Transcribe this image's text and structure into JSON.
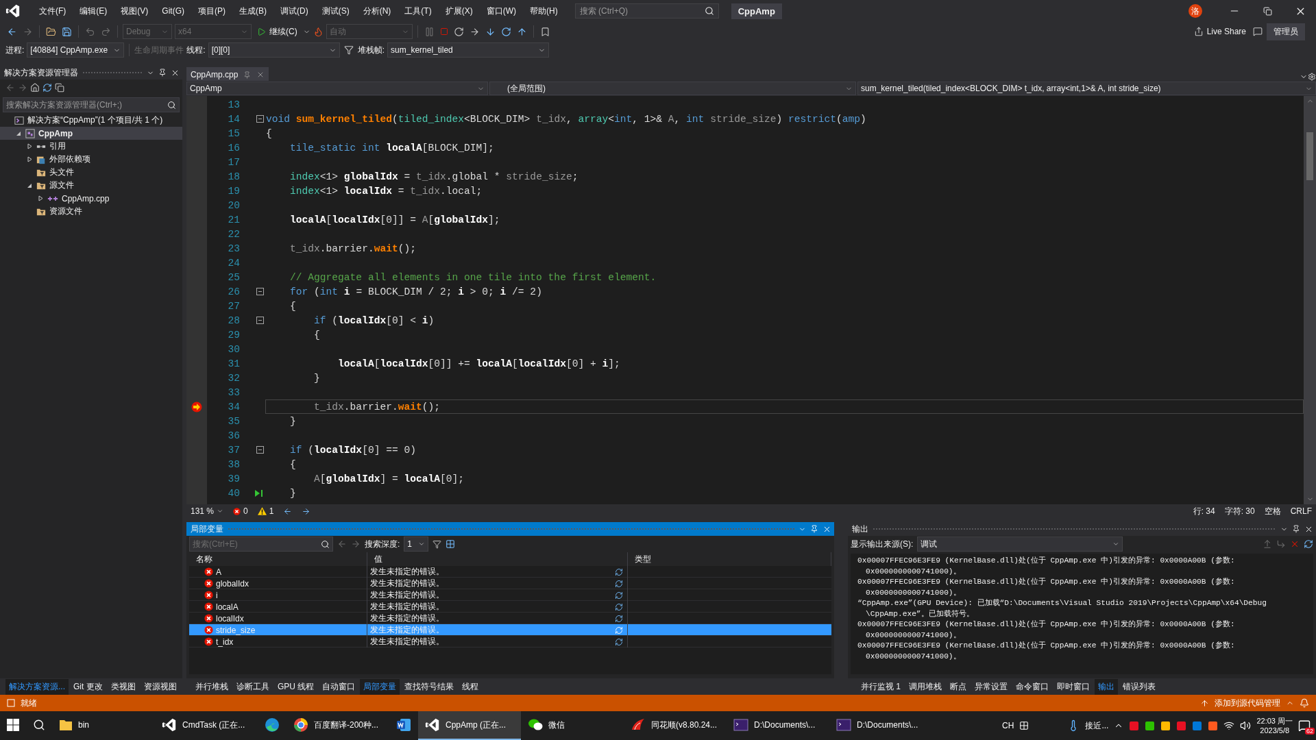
{
  "title_bar": {
    "menus": [
      "文件(F)",
      "编辑(E)",
      "视图(V)",
      "Git(G)",
      "项目(P)",
      "生成(B)",
      "调试(D)",
      "测试(S)",
      "分析(N)",
      "工具(T)",
      "扩展(X)",
      "窗口(W)",
      "帮助(H)"
    ],
    "search_placeholder": "搜索 (Ctrl+Q)",
    "title": "CppAmp",
    "avatar": "洛",
    "live_share": "Live Share",
    "admin": "管理员"
  },
  "toolbar": {
    "configuration": "Debug",
    "platform": "x64",
    "continue": "继续(C)",
    "auto": "自动"
  },
  "debug_location": {
    "process_label": "进程:",
    "process": "[40884] CppAmp.exe",
    "lifecycle": "生命周期事件",
    "thread_label": "线程:",
    "thread": "[0][0]",
    "frame_label": "堆栈帧:",
    "frame": "sum_kernel_tiled"
  },
  "solution_explorer": {
    "title": "解决方案资源管理器",
    "search_placeholder": "搜索解决方案资源管理器(Ctrl+;)",
    "tree": [
      {
        "label": "解决方案“CppAmp”(1 个项目/共 1 个)",
        "kind": "solution",
        "expandable": false,
        "expanded": true,
        "selected": false,
        "bold": false,
        "children": [
          {
            "label": "CppAmp",
            "kind": "project",
            "expandable": true,
            "expanded": true,
            "selected": true,
            "bold": true,
            "children": [
              {
                "label": "引用",
                "kind": "references",
                "expandable": true,
                "expanded": false,
                "selected": false,
                "bold": false
              },
              {
                "label": "外部依赖项",
                "kind": "dependencies",
                "expandable": true,
                "expanded": false,
                "selected": false,
                "bold": false
              },
              {
                "label": "头文件",
                "kind": "filter",
                "expandable": false,
                "selected": false,
                "bold": false
              },
              {
                "label": "源文件",
                "kind": "filter",
                "expandable": true,
                "expanded": true,
                "selected": false,
                "bold": false,
                "children": [
                  {
                    "label": "CppAmp.cpp",
                    "kind": "cpp",
                    "expandable": true,
                    "expanded": false,
                    "selected": false,
                    "bold": false
                  }
                ]
              },
              {
                "label": "资源文件",
                "kind": "filter",
                "expandable": false,
                "selected": false,
                "bold": false
              }
            ]
          }
        ]
      }
    ]
  },
  "editor": {
    "tab": "CppAmp.cpp",
    "project": "CppAmp",
    "scope": "(全局范围)",
    "member": "sum_kernel_tiled(tiled_index<BLOCK_DIM> t_idx, array<int,1>& A, int stride_size)",
    "lines": [
      {
        "number": "13",
        "kind": "plain",
        "fold": false
      },
      {
        "number": "14",
        "kind": "plain",
        "fold": true,
        "tokens": [
          {
            "kind": "kw",
            "text": "void "
          },
          {
            "kind": "fn",
            "text": "sum_kernel_tiled"
          },
          {
            "kind": "plain",
            "text": "("
          },
          {
            "kind": "type",
            "text": "tiled_index"
          },
          {
            "kind": "plain",
            "text": "<BLOCK_DIM> "
          },
          {
            "kind": "param",
            "text": "t_idx"
          },
          {
            "kind": "plain",
            "text": ", "
          },
          {
            "kind": "type",
            "text": "array"
          },
          {
            "kind": "plain",
            "text": "<"
          },
          {
            "kind": "kw",
            "text": "int"
          },
          {
            "kind": "plain",
            "text": ", 1>& "
          },
          {
            "kind": "param",
            "text": "A"
          },
          {
            "kind": "plain",
            "text": ", "
          },
          {
            "kind": "kw",
            "text": "int "
          },
          {
            "kind": "param",
            "text": "stride_size"
          },
          {
            "kind": "plain",
            "text": ") "
          },
          {
            "kind": "kw",
            "text": "restrict"
          },
          {
            "kind": "plain",
            "text": "("
          },
          {
            "kind": "kw",
            "text": "amp"
          },
          {
            "kind": "plain",
            "text": ")"
          }
        ]
      },
      {
        "number": "15",
        "kind": "plain",
        "fold": false,
        "tokens": [
          {
            "kind": "plain",
            "text": "{"
          }
        ]
      },
      {
        "number": "16",
        "kind": "plain",
        "fold": false,
        "tokens": [
          {
            "kind": "kw",
            "text": "    tile_static int "
          },
          {
            "kind": "var",
            "text": "localA"
          },
          {
            "kind": "plain",
            "text": "[BLOCK_DIM];"
          }
        ]
      },
      {
        "number": "17",
        "kind": "plain",
        "fold": false
      },
      {
        "number": "18",
        "kind": "plain",
        "fold": false,
        "tokens": [
          {
            "kind": "type",
            "text": "    index"
          },
          {
            "kind": "plain",
            "text": "<1> "
          },
          {
            "kind": "var",
            "text": "globalIdx"
          },
          {
            "kind": "plain",
            "text": " = "
          },
          {
            "kind": "param",
            "text": "t_idx"
          },
          {
            "kind": "plain",
            "text": ".global * "
          },
          {
            "kind": "param",
            "text": "stride_size"
          },
          {
            "kind": "plain",
            "text": ";"
          }
        ]
      },
      {
        "number": "19",
        "kind": "plain",
        "fold": false,
        "tokens": [
          {
            "kind": "type",
            "text": "    index"
          },
          {
            "kind": "plain",
            "text": "<1> "
          },
          {
            "kind": "var",
            "text": "localIdx"
          },
          {
            "kind": "plain",
            "text": " = "
          },
          {
            "kind": "param",
            "text": "t_idx"
          },
          {
            "kind": "plain",
            "text": ".local;"
          }
        ]
      },
      {
        "number": "20",
        "kind": "plain",
        "fold": false
      },
      {
        "number": "21",
        "kind": "plain",
        "fold": false,
        "tokens": [
          {
            "kind": "var",
            "text": "    localA"
          },
          {
            "kind": "plain",
            "text": "["
          },
          {
            "kind": "var",
            "text": "localIdx"
          },
          {
            "kind": "plain",
            "text": "[0]] = "
          },
          {
            "kind": "param",
            "text": "A"
          },
          {
            "kind": "plain",
            "text": "["
          },
          {
            "kind": "var",
            "text": "globalIdx"
          },
          {
            "kind": "plain",
            "text": "];"
          }
        ]
      },
      {
        "number": "22",
        "kind": "plain",
        "fold": false
      },
      {
        "number": "23",
        "kind": "plain",
        "fold": false,
        "tokens": [
          {
            "kind": "param",
            "text": "    t_idx"
          },
          {
            "kind": "plain",
            "text": ".barrier."
          },
          {
            "kind": "fn",
            "text": "wait"
          },
          {
            "kind": "plain",
            "text": "();"
          }
        ]
      },
      {
        "number": "24",
        "kind": "plain",
        "fold": false
      },
      {
        "number": "25",
        "kind": "plain",
        "fold": false,
        "tokens": [
          {
            "kind": "comment",
            "text": "    // Aggregate all elements in one tile into the first element."
          }
        ]
      },
      {
        "number": "26",
        "kind": "plain",
        "fold": true,
        "tokens": [
          {
            "kind": "kw",
            "text": "    for"
          },
          {
            "kind": "plain",
            "text": " ("
          },
          {
            "kind": "kw",
            "text": "int "
          },
          {
            "kind": "var",
            "text": "i"
          },
          {
            "kind": "plain",
            "text": " = BLOCK_DIM / 2; "
          },
          {
            "kind": "var",
            "text": "i"
          },
          {
            "kind": "plain",
            "text": " > 0; "
          },
          {
            "kind": "var",
            "text": "i"
          },
          {
            "kind": "plain",
            "text": " /= 2)"
          }
        ]
      },
      {
        "number": "27",
        "kind": "plain",
        "fold": false,
        "tokens": [
          {
            "kind": "plain",
            "text": "    {"
          }
        ]
      },
      {
        "number": "28",
        "kind": "plain",
        "fold": true,
        "tokens": [
          {
            "kind": "kw",
            "text": "        if"
          },
          {
            "kind": "plain",
            "text": " ("
          },
          {
            "kind": "var",
            "text": "localIdx"
          },
          {
            "kind": "plain",
            "text": "[0] < "
          },
          {
            "kind": "var",
            "text": "i"
          },
          {
            "kind": "plain",
            "text": ")"
          }
        ]
      },
      {
        "number": "29",
        "kind": "plain",
        "fold": false,
        "tokens": [
          {
            "kind": "plain",
            "text": "        {"
          }
        ]
      },
      {
        "number": "30",
        "kind": "plain",
        "fold": false
      },
      {
        "number": "31",
        "kind": "plain",
        "fold": false,
        "tokens": [
          {
            "kind": "var",
            "text": "            localA"
          },
          {
            "kind": "plain",
            "text": "["
          },
          {
            "kind": "var",
            "text": "localIdx"
          },
          {
            "kind": "plain",
            "text": "[0]] += "
          },
          {
            "kind": "var",
            "text": "localA"
          },
          {
            "kind": "plain",
            "text": "["
          },
          {
            "kind": "var",
            "text": "localIdx"
          },
          {
            "kind": "plain",
            "text": "[0] + "
          },
          {
            "kind": "var",
            "text": "i"
          },
          {
            "kind": "plain",
            "text": "];"
          }
        ]
      },
      {
        "number": "32",
        "kind": "plain",
        "fold": false,
        "tokens": [
          {
            "kind": "plain",
            "text": "        }"
          }
        ]
      },
      {
        "number": "33",
        "kind": "plain",
        "fold": false
      },
      {
        "number": "34",
        "kind": "current",
        "fold": false,
        "tokens": [
          {
            "kind": "param",
            "text": "        t_idx"
          },
          {
            "kind": "plain",
            "text": ".barrier."
          },
          {
            "kind": "fn",
            "text": "wait"
          },
          {
            "kind": "plain",
            "text": "();"
          }
        ]
      },
      {
        "number": "35",
        "kind": "plain",
        "fold": false,
        "tokens": [
          {
            "kind": "plain",
            "text": "    }"
          }
        ]
      },
      {
        "number": "36",
        "kind": "plain",
        "fold": false
      },
      {
        "number": "37",
        "kind": "plain",
        "fold": true,
        "tokens": [
          {
            "kind": "kw",
            "text": "    if"
          },
          {
            "kind": "plain",
            "text": " ("
          },
          {
            "kind": "var",
            "text": "localIdx"
          },
          {
            "kind": "plain",
            "text": "[0] == 0)"
          }
        ]
      },
      {
        "number": "38",
        "kind": "plain",
        "fold": false,
        "tokens": [
          {
            "kind": "plain",
            "text": "    {"
          }
        ]
      },
      {
        "number": "39",
        "kind": "plain",
        "fold": false,
        "tokens": [
          {
            "kind": "param",
            "text": "        A"
          },
          {
            "kind": "plain",
            "text": "["
          },
          {
            "kind": "var",
            "text": "globalIdx"
          },
          {
            "kind": "plain",
            "text": "] = "
          },
          {
            "kind": "var",
            "text": "localA"
          },
          {
            "kind": "plain",
            "text": "[0];"
          }
        ]
      },
      {
        "number": "40",
        "kind": "run-to-click",
        "fold": false,
        "tokens": [
          {
            "kind": "plain",
            "text": "    }"
          }
        ]
      }
    ],
    "status": {
      "zoom": "131 %",
      "errors": "0",
      "warnings": "1",
      "line": "行: 34",
      "char": "字符: 30",
      "indent": "空格",
      "eol": "CRLF"
    }
  },
  "locals": {
    "title": "局部变量",
    "search_placeholder": "搜索(Ctrl+E)",
    "depth_label": "搜索深度:",
    "depth": "1",
    "columns": [
      "名称",
      "值",
      "类型"
    ],
    "rows": [
      {
        "name": "A",
        "value": "发生未指定的错误。",
        "selected": false
      },
      {
        "name": "globalIdx",
        "value": "发生未指定的错误。",
        "selected": false
      },
      {
        "name": "i",
        "value": "发生未指定的错误。",
        "selected": false
      },
      {
        "name": "localA",
        "value": "发生未指定的错误。",
        "selected": false
      },
      {
        "name": "localIdx",
        "value": "发生未指定的错误。",
        "selected": false
      },
      {
        "name": "stride_size",
        "value": "发生未指定的错误。",
        "selected": true
      },
      {
        "name": "t_idx",
        "value": "发生未指定的错误。",
        "selected": false
      }
    ]
  },
  "output": {
    "title": "输出",
    "source_label": "显示输出来源(S):",
    "source": "调试",
    "lines": [
      {
        "kind": "first",
        "text": "0x00007FFEC96E3FE9 (KernelBase.dll)处(位于 CppAmp.exe 中)引发的异常: 0x0000A00B (参数:"
      },
      {
        "kind": "wrap",
        "text": "0x0000000000741000)。"
      },
      {
        "kind": "first",
        "text": "0x00007FFEC96E3FE9 (KernelBase.dll)处(位于 CppAmp.exe 中)引发的异常: 0x0000A00B (参数:"
      },
      {
        "kind": "wrap",
        "text": "0x0000000000741000)。"
      },
      {
        "kind": "first",
        "text": "“CppAmp.exe”(GPU Device): 已加载“D:\\Documents\\Visual Studio 2019\\Projects\\CppAmp\\x64\\Debug"
      },
      {
        "kind": "wrap",
        "text": "\\CppAmp.exe”。已加载符号。"
      },
      {
        "kind": "first",
        "text": "0x00007FFEC96E3FE9 (KernelBase.dll)处(位于 CppAmp.exe 中)引发的异常: 0x0000A00B (参数:"
      },
      {
        "kind": "wrap",
        "text": "0x0000000000741000)。"
      },
      {
        "kind": "first",
        "text": "0x00007FFEC96E3FE9 (KernelBase.dll)处(位于 CppAmp.exe 中)引发的异常: 0x0000A00B (参数:"
      },
      {
        "kind": "wrap",
        "text": "0x0000000000741000)。"
      }
    ]
  },
  "left_tabs": [
    {
      "label": "解决方案资源...",
      "selected": true
    },
    {
      "label": "Git 更改",
      "selected": false
    },
    {
      "label": "类视图",
      "selected": false
    },
    {
      "label": "资源视图",
      "selected": false
    }
  ],
  "center_tabs": [
    {
      "label": "并行堆栈",
      "selected": false
    },
    {
      "label": "诊断工具",
      "selected": false
    },
    {
      "label": "GPU 线程",
      "selected": false
    },
    {
      "label": "自动窗口",
      "selected": false
    },
    {
      "label": "局部变量",
      "selected": true
    },
    {
      "label": "查找符号结果",
      "selected": false
    },
    {
      "label": "线程",
      "selected": false
    }
  ],
  "right_tabs": [
    {
      "label": "并行监视 1",
      "selected": false
    },
    {
      "label": "调用堆栈",
      "selected": false
    },
    {
      "label": "断点",
      "selected": false
    },
    {
      "label": "异常设置",
      "selected": false
    },
    {
      "label": "命令窗口",
      "selected": false
    },
    {
      "label": "即时窗口",
      "selected": false
    },
    {
      "label": "输出",
      "selected": true
    },
    {
      "label": "错误列表",
      "selected": false
    }
  ],
  "status_bar": {
    "text": "就绪",
    "source_control": "添加到源代码管理"
  },
  "taskbar": {
    "apps": [
      {
        "kind": "folder",
        "label": "bin",
        "selected": false
      },
      {
        "kind": "vs",
        "label": "CmdTask (正在...",
        "selected": false
      },
      {
        "kind": "edge",
        "selected": false
      },
      {
        "kind": "browser",
        "label": "百度翻译-200种...",
        "selected": false
      },
      {
        "kind": "word",
        "selected": false
      },
      {
        "kind": "vs",
        "label": "CppAmp (正在...",
        "selected": true
      },
      {
        "kind": "chat",
        "label": "微信",
        "selected": false
      },
      {
        "kind": "stock",
        "label": "同花顺(v8.80.24...",
        "selected": false
      },
      {
        "kind": "terminal",
        "label": "D:\\Documents\\...",
        "selected": false
      },
      {
        "kind": "terminal",
        "label": "D:\\Documents\\...",
        "selected": false
      }
    ],
    "ime": "CH",
    "weather": "接近...",
    "time": "22:03 周一",
    "date": "2023/5/8",
    "badge": "62"
  }
}
